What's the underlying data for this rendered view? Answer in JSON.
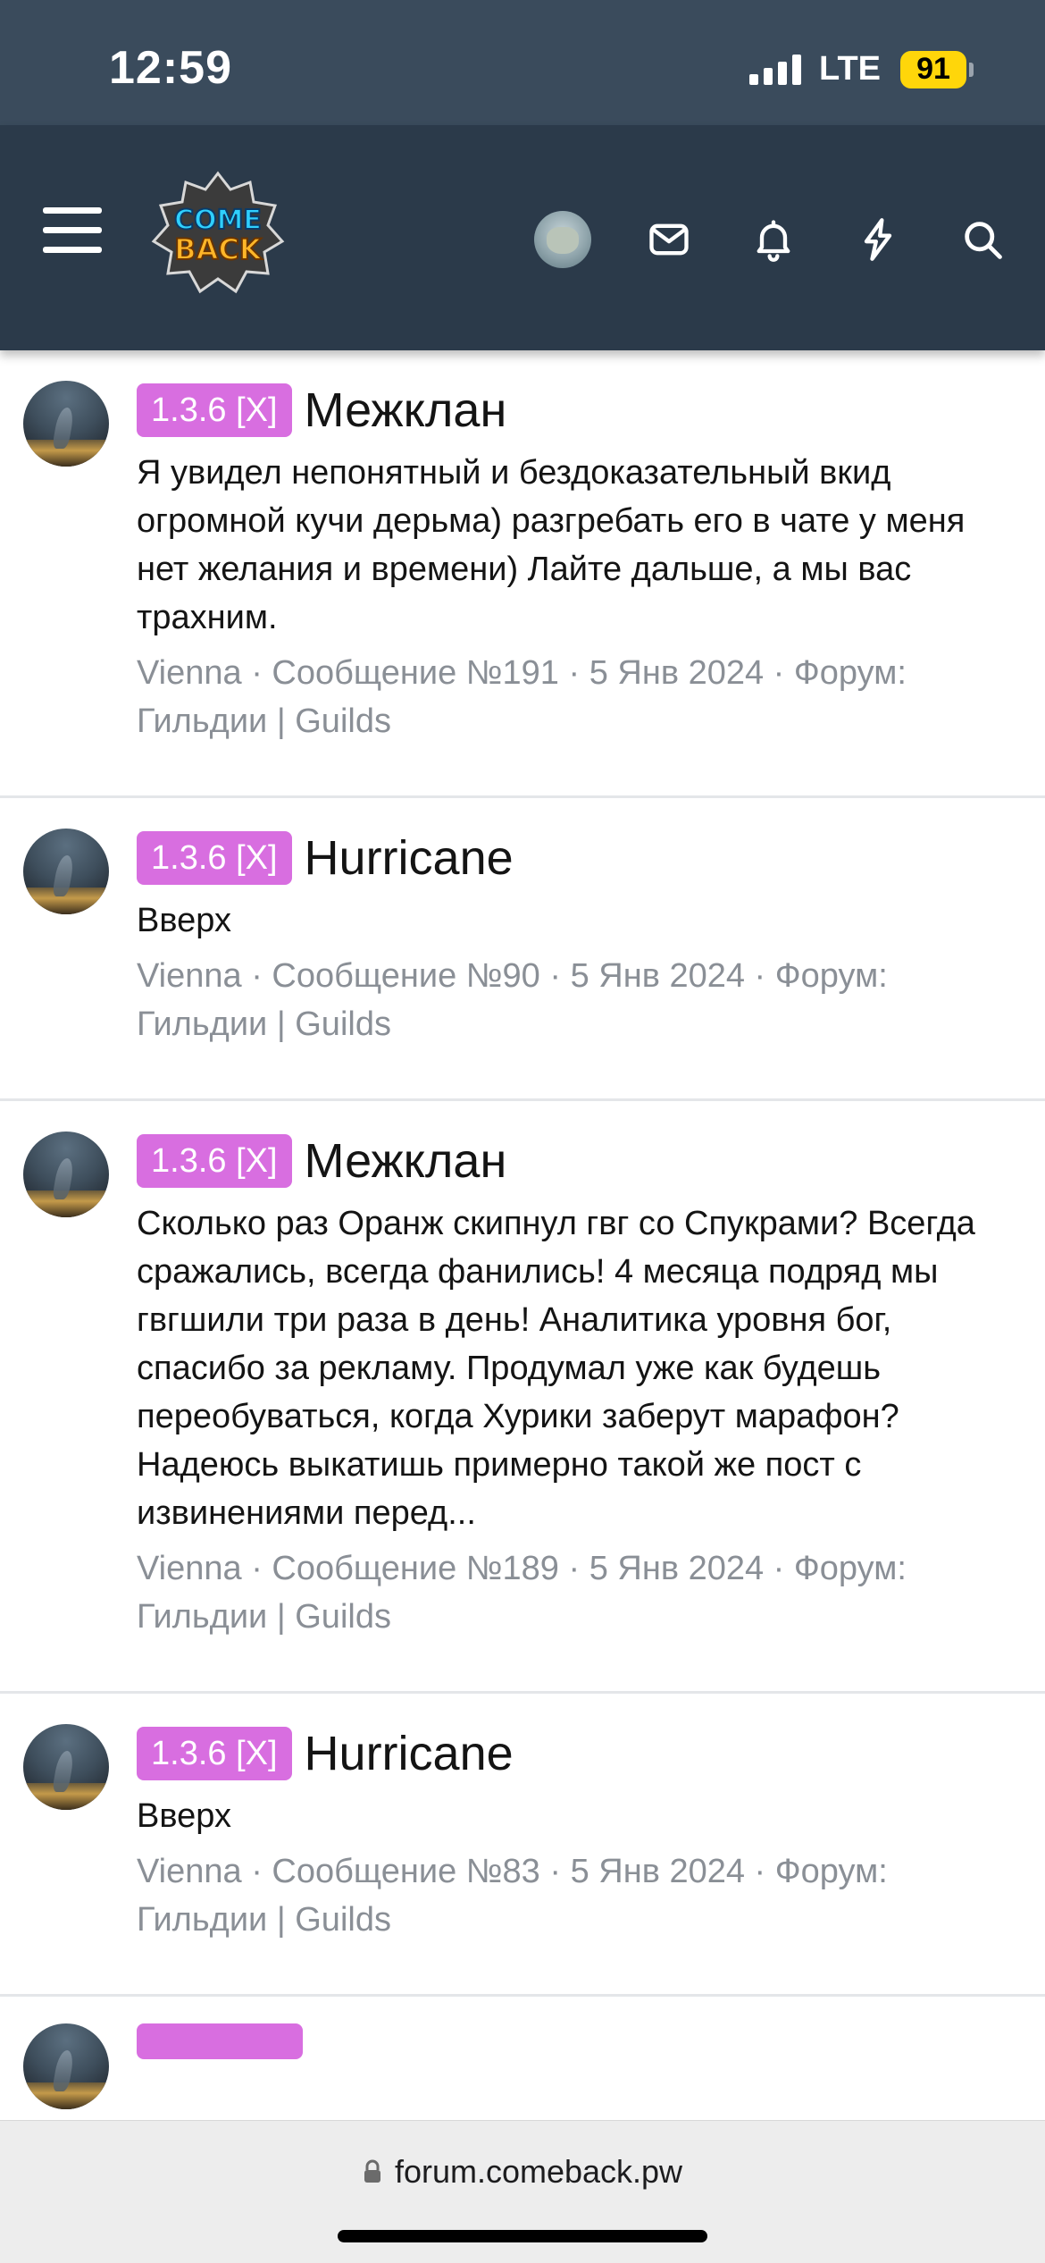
{
  "status_bar": {
    "time": "12:59",
    "network": "LTE",
    "battery": "91"
  },
  "header": {
    "logo_lines": [
      "COME",
      "BACK"
    ],
    "icons": [
      "menu-icon",
      "avatar",
      "envelope-icon",
      "bell-icon",
      "lightning-icon",
      "search-icon"
    ]
  },
  "posts": [
    {
      "prefix": "1.3.6 [X]",
      "title": "Межклан",
      "snippet": "Я увидел непонятный и бездоказательный вкид огромной кучи дерьма) разгребать его в чате у меня нет желания и времени) Лайте дальше, а мы вас трахним.",
      "author": "Vienna",
      "message": "Сообщение №191",
      "date": "5 Янв 2024",
      "forum_label": "Форум:",
      "forum": "Гильдии | Guilds"
    },
    {
      "prefix": "1.3.6 [X]",
      "title": "Hurricane",
      "snippet": "Вверх",
      "author": "Vienna",
      "message": "Сообщение №90",
      "date": "5 Янв 2024",
      "forum_label": "Форум:",
      "forum": "Гильдии | Guilds"
    },
    {
      "prefix": "1.3.6 [X]",
      "title": "Межклан",
      "snippet": "Сколько раз Оранж скипнул гвг со Спукрами? Всегда сражались, всегда фанились! 4 месяца подряд мы гвгшили три раза в день! Аналитика уровня бог, спасибо за рекламу. Продумал уже как будешь переобуваться, когда Хурики заберут марафон? Надеюсь выкатишь примерно такой же пост с извинениями перед...",
      "author": "Vienna",
      "message": "Сообщение №189",
      "date": "5 Янв 2024",
      "forum_label": "Форум:",
      "forum": "Гильдии | Guilds"
    },
    {
      "prefix": "1.3.6 [X]",
      "title": "Hurricane",
      "snippet": "Вверх",
      "author": "Vienna",
      "message": "Сообщение №83",
      "date": "5 Янв 2024",
      "forum_label": "Форум:",
      "forum": "Гильдии | Guilds"
    }
  ],
  "meta_separator": " · ",
  "browser": {
    "url": "forum.comeback.pw"
  },
  "colors": {
    "status_bar_bg": "#3a4b5c",
    "header_bg": "#2b3a4a",
    "prefix_bg": "#d86ee0",
    "meta_text": "#8a8f96",
    "battery": "#ffd60a"
  }
}
